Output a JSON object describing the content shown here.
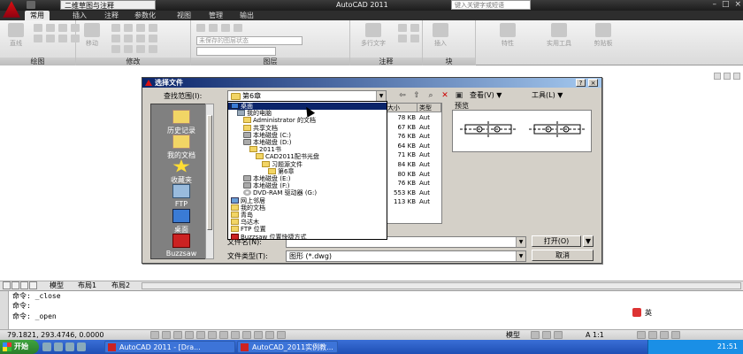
{
  "window": {
    "workspace": "二维草图与注释",
    "title": "AutoCAD 2011",
    "search_placeholder": "键入关键字或短语",
    "controls": [
      "–",
      "□",
      "×"
    ]
  },
  "ribbon": {
    "tabs": [
      "常用",
      "插入",
      "注释",
      "参数化",
      "视图",
      "管理",
      "输出"
    ],
    "active_tab": "常用",
    "buttons": {
      "line": "直线",
      "move": "移动",
      "layer_state": "未保存的图层状态",
      "multiline_text": "多行文字",
      "insert": "插入",
      "properties": "特性",
      "utilities": "实用工具",
      "clipboard": "剪贴板"
    },
    "groups": [
      "绘图",
      "修改",
      "图层",
      "注释",
      "块"
    ]
  },
  "model_tabs": [
    "模型",
    "布局1",
    "布局2"
  ],
  "command_lines": [
    "命令: _close",
    "命令:",
    "命令: _open"
  ],
  "ime": {
    "lang": "英"
  },
  "status": {
    "coords": "79.1821,  293.4746, 0.0000",
    "model": "模型",
    "scale": "A 1:1"
  },
  "taskbar": {
    "start": "开始",
    "tasks": [
      "AutoCAD 2011 - [Dra...",
      "AutoCAD_2011实例教..."
    ],
    "clock": "21:51"
  },
  "dialog": {
    "title": "选择文件",
    "look_in_label": "查找范围(I):",
    "look_in_value": "第6章",
    "view_label": "查看(V)",
    "tools_label": "工具(L)",
    "preview_label": "预览",
    "places": [
      "历史记录",
      "我的文档",
      "收藏夹",
      "FTP",
      "桌面",
      "Buzzsaw"
    ],
    "list_headers": [
      "大小",
      "类型"
    ],
    "list_rows": [
      {
        "size": "78 KB",
        "type": "Aut"
      },
      {
        "size": "67 KB",
        "type": "Aut"
      },
      {
        "size": "76 KB",
        "type": "Aut"
      },
      {
        "size": "64 KB",
        "type": "Aut"
      },
      {
        "size": "71 KB",
        "type": "Aut"
      },
      {
        "size": "84 KB",
        "type": "Aut"
      },
      {
        "size": "80 KB",
        "type": "Aut"
      },
      {
        "size": "76 KB",
        "type": "Aut"
      },
      {
        "size": "553 KB",
        "type": "Aut"
      },
      {
        "size": "113 KB",
        "type": "Aut"
      }
    ],
    "filename_label": "文件名(N):",
    "filetype_label": "文件类型(T):",
    "filetype_value": "图形 (*.dwg)",
    "open_button": "打开(O)",
    "cancel_button": "取消",
    "dropdown_items": [
      {
        "label": "桌面",
        "icon": "desk",
        "indent": 0,
        "selected": true
      },
      {
        "label": "我的电脑",
        "icon": "pc",
        "indent": 1
      },
      {
        "label": "Administrator 的文档",
        "icon": "folder",
        "indent": 2
      },
      {
        "label": "共享文档",
        "icon": "folder",
        "indent": 2
      },
      {
        "label": "本地磁盘 (C:)",
        "icon": "drive",
        "indent": 2
      },
      {
        "label": "本地磁盘 (D:)",
        "icon": "drive",
        "indent": 2
      },
      {
        "label": "2011书",
        "icon": "folder",
        "indent": 3
      },
      {
        "label": "CAD2011配书光盘",
        "icon": "folder",
        "indent": 4
      },
      {
        "label": "习题源文件",
        "icon": "folder",
        "indent": 5
      },
      {
        "label": "第6章",
        "icon": "folder",
        "indent": 6
      },
      {
        "label": "本地磁盘 (E:)",
        "icon": "drive",
        "indent": 2
      },
      {
        "label": "本地磁盘 (F:)",
        "icon": "drive",
        "indent": 2
      },
      {
        "label": "DVD-RAM 驱动器 (G:)",
        "icon": "cd",
        "indent": 2
      },
      {
        "label": "网上邻居",
        "icon": "net",
        "indent": 0
      },
      {
        "label": "我的文档",
        "icon": "folder",
        "indent": 0
      },
      {
        "label": "青岛",
        "icon": "folder",
        "indent": 0
      },
      {
        "label": "乌达木",
        "icon": "folder",
        "indent": 0
      },
      {
        "label": "FTP 位置",
        "icon": "folder",
        "indent": 0
      },
      {
        "label": "Buzzsaw 位置快捷方式",
        "icon": "bz",
        "indent": 0
      }
    ]
  }
}
